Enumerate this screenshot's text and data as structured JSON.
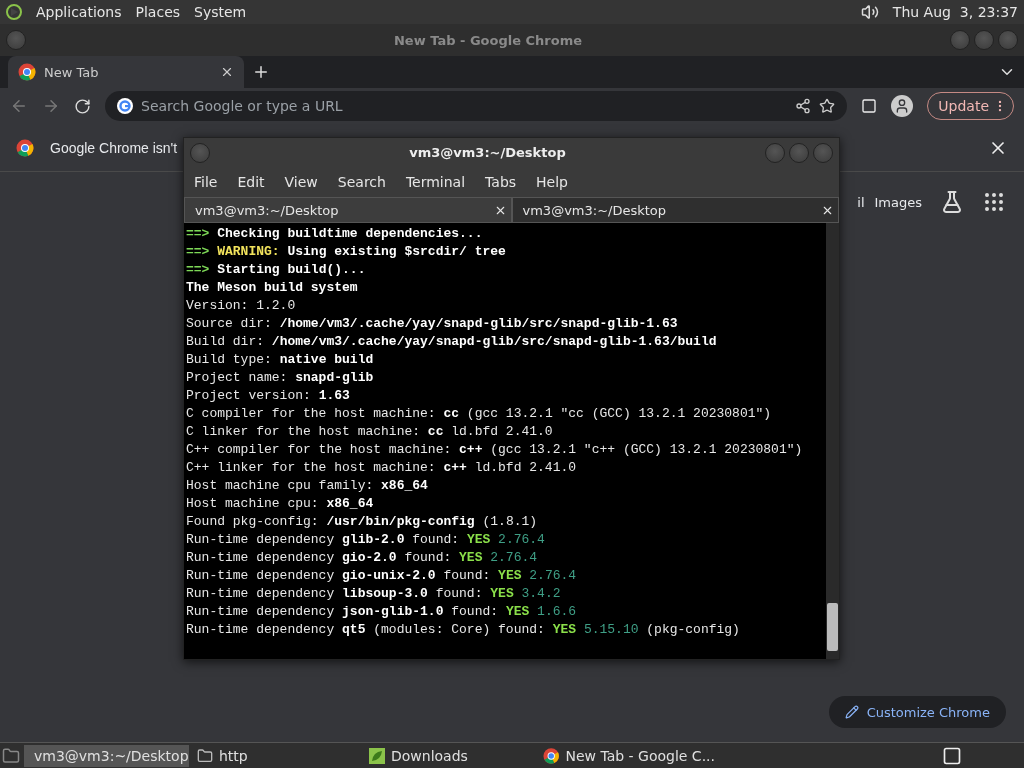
{
  "top_panel": {
    "menus": [
      "Applications",
      "Places",
      "System"
    ],
    "clock": "Thu Aug  3, 23:37"
  },
  "chrome": {
    "title": "New Tab - Google Chrome",
    "tabs": [
      {
        "label": "New Tab",
        "selected": true
      }
    ],
    "address": {
      "placeholder": "Search Google or type a URL"
    },
    "update_button": "Update",
    "infobar": "Google Chrome isn't",
    "partial_link": "il",
    "images_link": "Images",
    "customize_button": "Customize Chrome"
  },
  "terminal": {
    "title": "vm3@vm3:~/Desktop",
    "menus": [
      "File",
      "Edit",
      "View",
      "Search",
      "Terminal",
      "Tabs",
      "Help"
    ],
    "tabs": [
      {
        "label": "vm3@vm3:~/Desktop",
        "selected": true
      },
      {
        "label": "vm3@vm3:~/Desktop",
        "selected": false
      }
    ],
    "lines": [
      [
        {
          "kind": "arrow",
          "text": "==> "
        },
        {
          "kind": "bold",
          "text": "Checking buildtime dependencies..."
        }
      ],
      [
        {
          "kind": "arrow",
          "text": "==> "
        },
        {
          "kind": "warn",
          "text": "WARNING:"
        },
        {
          "kind": "bold",
          "text": " Using existing $srcdir/ tree"
        }
      ],
      [
        {
          "kind": "arrow",
          "text": "==> "
        },
        {
          "kind": "bold",
          "text": "Starting build()..."
        }
      ],
      [
        {
          "kind": "bold",
          "text": "The Meson build system"
        }
      ],
      [
        {
          "kind": "plain",
          "text": "Version: 1.2.0"
        }
      ],
      [
        {
          "kind": "plain",
          "text": "Source dir: "
        },
        {
          "kind": "bold",
          "text": "/home/vm3/.cache/yay/snapd-glib/src/snapd-glib-1.63"
        }
      ],
      [
        {
          "kind": "plain",
          "text": "Build dir: "
        },
        {
          "kind": "bold",
          "text": "/home/vm3/.cache/yay/snapd-glib/src/snapd-glib-1.63/build"
        }
      ],
      [
        {
          "kind": "plain",
          "text": "Build type: "
        },
        {
          "kind": "bold",
          "text": "native build"
        }
      ],
      [
        {
          "kind": "plain",
          "text": "Project name: "
        },
        {
          "kind": "bold",
          "text": "snapd-glib"
        }
      ],
      [
        {
          "kind": "plain",
          "text": "Project version: "
        },
        {
          "kind": "bold",
          "text": "1.63"
        }
      ],
      [
        {
          "kind": "plain",
          "text": "C compiler for the host machine: "
        },
        {
          "kind": "bold",
          "text": "cc"
        },
        {
          "kind": "plain",
          "text": " (gcc 13.2.1 \"cc (GCC) 13.2.1 20230801\")"
        }
      ],
      [
        {
          "kind": "plain",
          "text": "C linker for the host machine: "
        },
        {
          "kind": "bold",
          "text": "cc"
        },
        {
          "kind": "plain",
          "text": " ld.bfd 2.41.0"
        }
      ],
      [
        {
          "kind": "plain",
          "text": "C++ compiler for the host machine: "
        },
        {
          "kind": "bold",
          "text": "c++"
        },
        {
          "kind": "plain",
          "text": " (gcc 13.2.1 \"c++ (GCC) 13.2.1 20230801\")"
        }
      ],
      [
        {
          "kind": "plain",
          "text": "C++ linker for the host machine: "
        },
        {
          "kind": "bold",
          "text": "c++"
        },
        {
          "kind": "plain",
          "text": " ld.bfd 2.41.0"
        }
      ],
      [
        {
          "kind": "plain",
          "text": "Host machine cpu family: "
        },
        {
          "kind": "bold",
          "text": "x86_64"
        }
      ],
      [
        {
          "kind": "plain",
          "text": "Host machine cpu: "
        },
        {
          "kind": "bold",
          "text": "x86_64"
        }
      ],
      [
        {
          "kind": "plain",
          "text": "Found pkg-config: "
        },
        {
          "kind": "bold",
          "text": "/usr/bin/pkg-config"
        },
        {
          "kind": "plain",
          "text": " (1.8.1)"
        }
      ],
      [
        {
          "kind": "plain",
          "text": "Run-time dependency "
        },
        {
          "kind": "bold",
          "text": "glib-2.0"
        },
        {
          "kind": "plain",
          "text": " found: "
        },
        {
          "kind": "yes",
          "text": "YES"
        },
        {
          "kind": "version",
          "text": " 2.76.4"
        }
      ],
      [
        {
          "kind": "plain",
          "text": "Run-time dependency "
        },
        {
          "kind": "bold",
          "text": "gio-2.0"
        },
        {
          "kind": "plain",
          "text": " found: "
        },
        {
          "kind": "yes",
          "text": "YES"
        },
        {
          "kind": "version",
          "text": " 2.76.4"
        }
      ],
      [
        {
          "kind": "plain",
          "text": "Run-time dependency "
        },
        {
          "kind": "bold",
          "text": "gio-unix-2.0"
        },
        {
          "kind": "plain",
          "text": " found: "
        },
        {
          "kind": "yes",
          "text": "YES"
        },
        {
          "kind": "version",
          "text": " 2.76.4"
        }
      ],
      [
        {
          "kind": "plain",
          "text": "Run-time dependency "
        },
        {
          "kind": "bold",
          "text": "libsoup-3.0"
        },
        {
          "kind": "plain",
          "text": " found: "
        },
        {
          "kind": "yes",
          "text": "YES"
        },
        {
          "kind": "version",
          "text": " 3.4.2"
        }
      ],
      [
        {
          "kind": "plain",
          "text": "Run-time dependency "
        },
        {
          "kind": "bold",
          "text": "json-glib-1.0"
        },
        {
          "kind": "plain",
          "text": " found: "
        },
        {
          "kind": "yes",
          "text": "YES"
        },
        {
          "kind": "version",
          "text": " 1.6.6"
        }
      ],
      [
        {
          "kind": "plain",
          "text": "Run-time dependency "
        },
        {
          "kind": "bold",
          "text": "qt5"
        },
        {
          "kind": "plain",
          "text": " (modules: Core) found: "
        },
        {
          "kind": "yes",
          "text": "YES"
        },
        {
          "kind": "version",
          "text": " 5.15.10"
        },
        {
          "kind": "plain",
          "text": " (pkg-config)"
        }
      ]
    ]
  },
  "taskbar": {
    "items": [
      {
        "kind": "terminal",
        "label": "vm3@vm3:~/Desktop",
        "selected": true
      },
      {
        "kind": "folder",
        "label": "http",
        "selected": false
      },
      {
        "kind": "downloads",
        "label": "Downloads",
        "selected": false
      },
      {
        "kind": "browser",
        "label": "New Tab - Google C...",
        "selected": false
      }
    ]
  }
}
